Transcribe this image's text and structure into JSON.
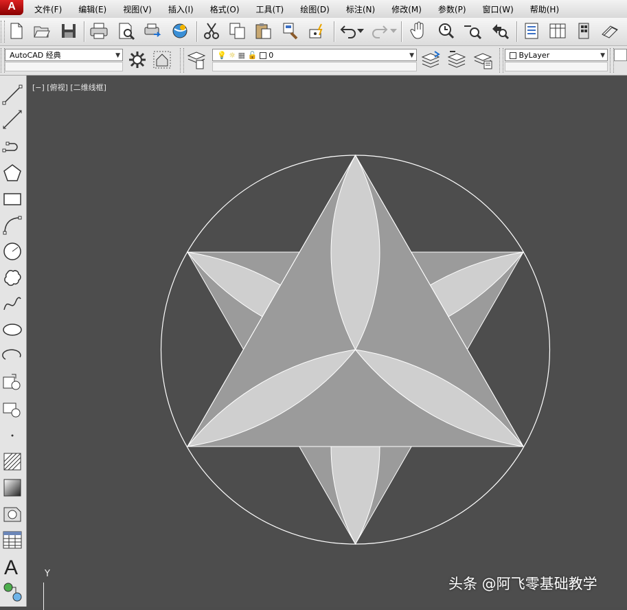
{
  "app": {
    "logo_letter": "A"
  },
  "menu": [
    "文件(F)",
    "编辑(E)",
    "视图(V)",
    "插入(I)",
    "格式(O)",
    "工具(T)",
    "绘图(D)",
    "标注(N)",
    "修改(M)",
    "参数(P)",
    "窗口(W)",
    "帮助(H)"
  ],
  "workspace": {
    "selected": "AutoCAD 经典"
  },
  "layer": {
    "current": "0"
  },
  "color": {
    "selected": "ByLayer"
  },
  "viewport": {
    "label": "[−] [俯视] [二维线框]",
    "ucs_y": "Y"
  },
  "watermark": "头条 @阿飞零基础教学",
  "colors": {
    "background": "#4d4d4d",
    "light_fill": "#cfcfcf",
    "mid_fill": "#9b9b9b",
    "stroke": "#ffffff"
  }
}
